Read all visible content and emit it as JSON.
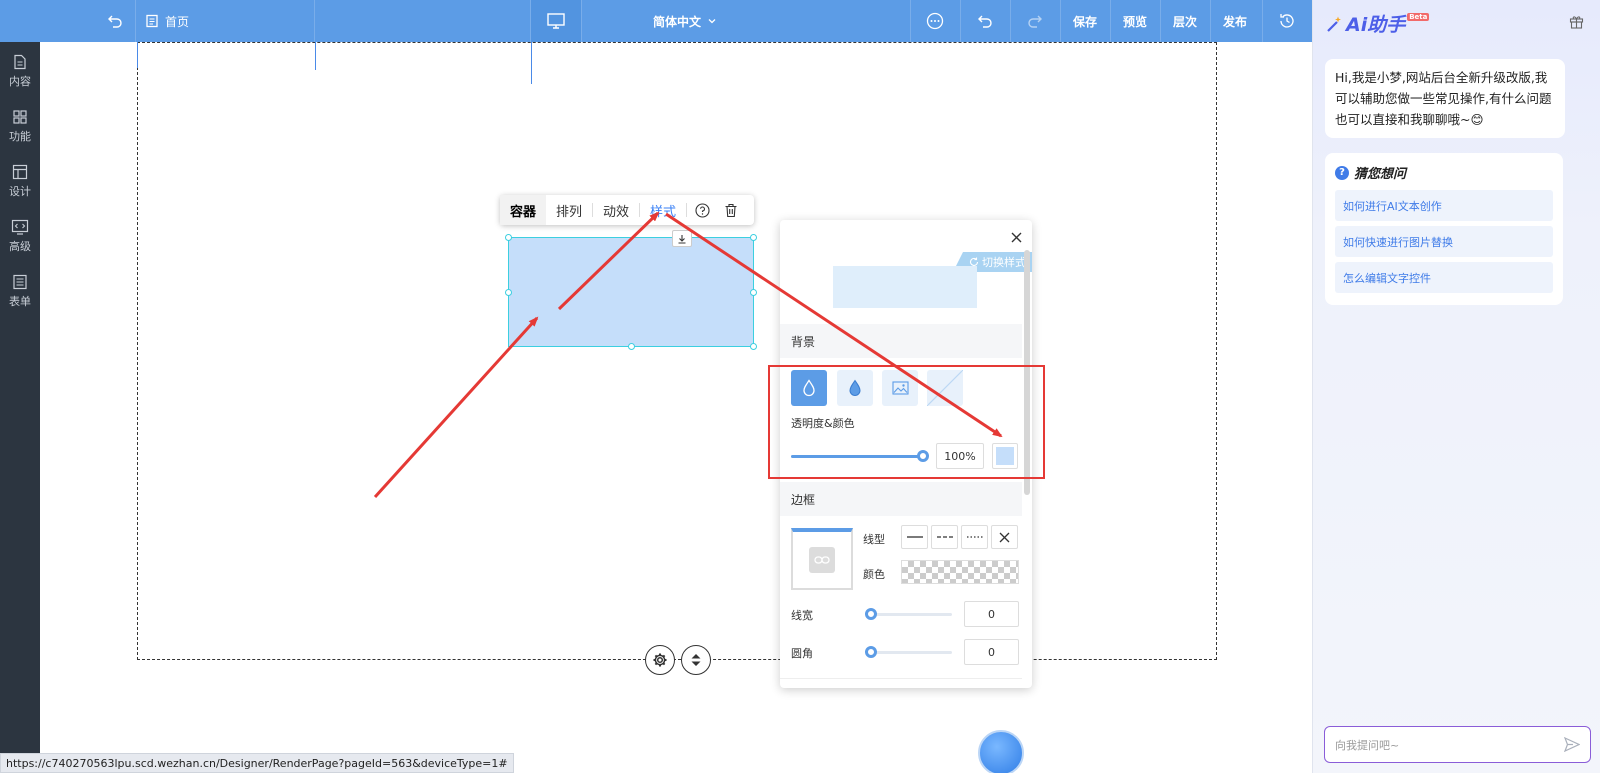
{
  "topbar": {
    "home_label": "首页",
    "language": "简体中文",
    "save": "保存",
    "preview": "预览",
    "layers": "层次",
    "publish": "发布"
  },
  "sidebar": {
    "items": [
      {
        "label": "内容",
        "icon": "document-icon"
      },
      {
        "label": "功能",
        "icon": "grid-icon"
      },
      {
        "label": "设计",
        "icon": "layout-icon"
      },
      {
        "label": "高级",
        "icon": "code-icon"
      },
      {
        "label": "表单",
        "icon": "form-icon"
      }
    ]
  },
  "context_toolbar": {
    "container": "容器",
    "arrange": "排列",
    "animation": "动效",
    "style": "样式"
  },
  "style_panel": {
    "switch_style": "切换样式",
    "background_section": "背景",
    "opacity_color_label": "透明度&颜色",
    "opacity_value": "100%",
    "opacity_level": 1.0,
    "bg_color": "#c5defa",
    "border_section": "边框",
    "line_type_label": "线型",
    "color_label": "颜色",
    "line_width_label": "线宽",
    "line_width_value": "0",
    "radius_label": "圆角",
    "radius_value": "0"
  },
  "ai_panel": {
    "title": "Ai助手",
    "beta": "Beta",
    "welcome": "Hi,我是小梦,网站后台全新升级改版,我可以辅助您做一些常见操作,有什么问题也可以直接和我聊聊哦~😊",
    "faq_title": "猜您想问",
    "faq": [
      "如何进行AI文本创作",
      "如何快速进行图片替换",
      "怎么编辑文字控件"
    ],
    "input_placeholder": "向我提问吧~"
  },
  "status_url": "https://c740270563lpu.scd.wezhan.cn/Designer/RenderPage?pageId=563&deviceType=1#",
  "colors": {
    "topbar": "#5c9ce6",
    "sidebar": "#2c3540",
    "annotation_red": "#e53935",
    "accent_blue": "#3b82f6"
  }
}
